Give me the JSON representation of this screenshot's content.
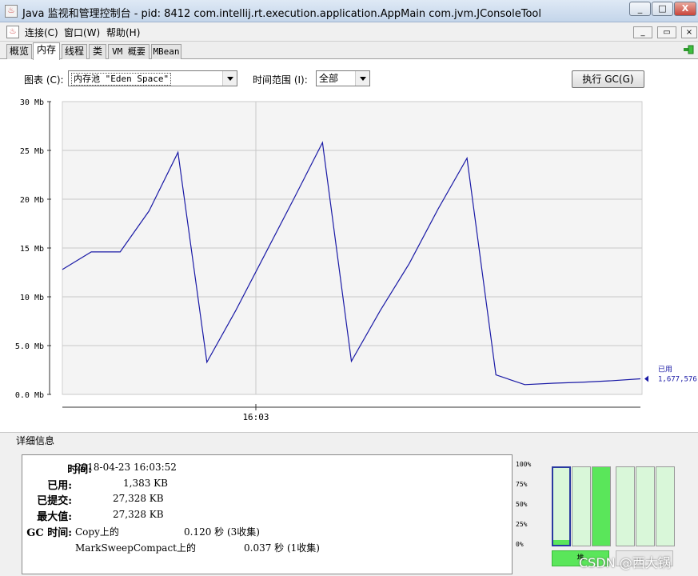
{
  "window": {
    "title": "Java 监视和管理控制台 - pid: 8412 com.intellij.rt.execution.application.AppMain com.jvm.JConsoleTool",
    "minimize": "_",
    "maximize": "□",
    "close": "X"
  },
  "menubar": {
    "items": [
      {
        "label": "连接(C)"
      },
      {
        "label": "窗口(W)"
      },
      {
        "label": "帮助(H)"
      }
    ],
    "mdi_min": "_",
    "mdi_restore": "▭",
    "mdi_close": "×"
  },
  "tabs": [
    {
      "label": "概览",
      "active": false
    },
    {
      "label": "内存",
      "active": true
    },
    {
      "label": "线程",
      "active": false
    },
    {
      "label": "类",
      "active": false
    },
    {
      "label": "VM 概要",
      "active": false
    },
    {
      "label": "MBean",
      "active": false
    }
  ],
  "controls": {
    "chart_label": "图表 (C):",
    "chart_value": "内存池 \"Eden Space\"",
    "range_label": "时间范围 (I):",
    "range_value": "全部",
    "gc_button": "执行 GC(G)"
  },
  "chart_data": {
    "type": "line",
    "title": "",
    "xlabel": "",
    "ylabel": "",
    "ylim": [
      0,
      30
    ],
    "y_ticks": [
      "30 Mb",
      "25 Mb",
      "20 Mb",
      "15 Mb",
      "10 Mb",
      "5.0 Mb",
      "0.0 Mb"
    ],
    "y_tick_values": [
      30,
      25,
      20,
      15,
      10,
      5,
      0
    ],
    "x_tick_labels": [
      "16:03"
    ],
    "grid": true,
    "series": [
      {
        "name": "已用",
        "color": "#1a1aa6",
        "values": [
          12.8,
          14.6,
          14.6,
          18.8,
          24.8,
          3.3,
          8.6,
          14.3,
          20.0,
          25.8,
          3.4,
          8.6,
          13.4,
          19.0,
          24.2,
          2.0,
          1.0,
          1.15,
          1.25,
          1.4,
          1.6
        ]
      }
    ],
    "legend_label": "已用",
    "legend_value": "1,677,576",
    "legend_placement": "right"
  },
  "details": {
    "section_title": "详细信息",
    "time_label": "时间:",
    "time_value": "2018-04-23 16:03:52",
    "used_label": "已用:",
    "used_value": "1,383 KB",
    "committed_label": "已提交:",
    "committed_value": "27,328 KB",
    "max_label": "最大值:",
    "max_value": "27,328 KB",
    "gc_label": "GC 时间:",
    "gc_rows": [
      {
        "name": "Copy上的",
        "time": "0.120 秒 (3收集)"
      },
      {
        "name": "MarkSweepCompact上的",
        "time": "0.037 秒 (1收集)"
      }
    ]
  },
  "pools": {
    "pct_labels": [
      "100%",
      "75%",
      "50%",
      "25%",
      "0%"
    ],
    "bars": [
      {
        "fill": 0.06,
        "selected": true
      },
      {
        "fill": 0.0,
        "selected": false
      },
      {
        "fill": 1.0,
        "selected": false
      },
      {
        "fill": 0.0,
        "selected": false
      },
      {
        "fill": 0.0,
        "selected": false
      },
      {
        "fill": 0.0,
        "selected": false
      }
    ],
    "heap_label": "堆",
    "nonheap_label": "非堆"
  },
  "watermark": "CSDN @西大锅"
}
